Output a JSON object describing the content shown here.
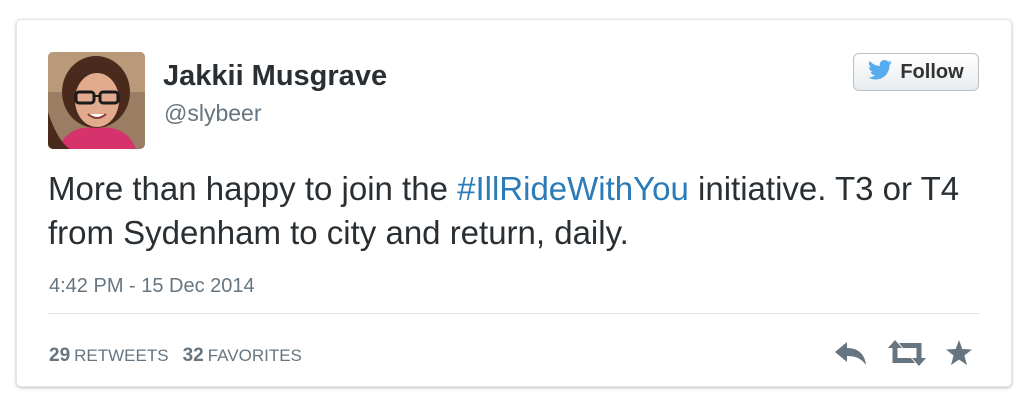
{
  "user": {
    "name": "Jakkii Musgrave",
    "handle": "@slybeer"
  },
  "follow": {
    "label": "Follow",
    "icon": "twitter-bird-icon"
  },
  "tweet": {
    "text_before": "More than happy to join the ",
    "hashtag": "#IllRideWithYou",
    "text_after": " initiative. T3 or T4 from Sydenham to city and return, daily.",
    "timestamp": "4:42 PM - 15 Dec 2014"
  },
  "stats": {
    "retweets_count": "29",
    "retweets_label": "RETWEETS",
    "favorites_count": "32",
    "favorites_label": "FAVORITES"
  },
  "actions": {
    "reply_icon": "reply-icon",
    "retweet_icon": "retweet-icon",
    "favorite_icon": "star-icon"
  },
  "colors": {
    "hashtag": "#2b7bb9",
    "text": "#292f33",
    "muted": "#66757f",
    "twitter_blue": "#55acee",
    "action_gray": "#66757f"
  }
}
